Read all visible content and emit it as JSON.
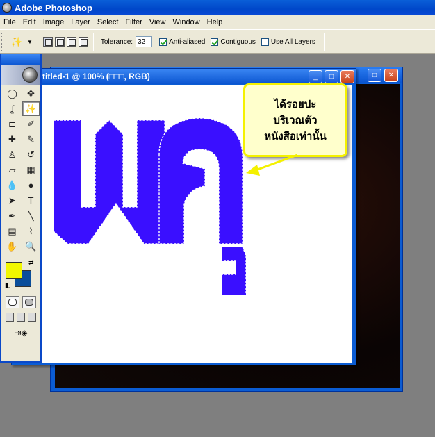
{
  "app": {
    "title": "Adobe Photoshop"
  },
  "menu": [
    "File",
    "Edit",
    "Image",
    "Layer",
    "Select",
    "Filter",
    "View",
    "Window",
    "Help"
  ],
  "options": {
    "tolerance_label": "Tolerance:",
    "tolerance_value": "32",
    "antialiased_label": "Anti-aliased",
    "antialiased_checked": true,
    "contiguous_label": "Contiguous",
    "contiguous_checked": true,
    "all_layers_label": "Use All Layers",
    "all_layers_checked": false
  },
  "document": {
    "title": "titled-1 @ 100% (□□□, RGB)",
    "canvas_text": "พฺลุ",
    "text_color": "#3a0fff"
  },
  "callout": {
    "lines": [
      "ได้รอยปะ",
      "บริเวณตัว",
      "หนังสือเท่านั้น"
    ],
    "arrow_color": "#f4f100"
  },
  "toolbox": {
    "foreground_color": "#f2f700",
    "background_color": "#0a4e9b",
    "tools": [
      {
        "name": "marquee-tool",
        "icon": "◯"
      },
      {
        "name": "move-tool",
        "icon": "✥"
      },
      {
        "name": "lasso-tool",
        "icon": "ʆ"
      },
      {
        "name": "magic-wand-tool",
        "icon": "✨"
      },
      {
        "name": "crop-tool",
        "icon": "⊏"
      },
      {
        "name": "slice-tool",
        "icon": "✐"
      },
      {
        "name": "healing-brush-tool",
        "icon": "✚"
      },
      {
        "name": "brush-tool",
        "icon": "✎"
      },
      {
        "name": "clone-stamp-tool",
        "icon": "♙"
      },
      {
        "name": "history-brush-tool",
        "icon": "↺"
      },
      {
        "name": "eraser-tool",
        "icon": "▱"
      },
      {
        "name": "gradient-tool",
        "icon": "▦"
      },
      {
        "name": "blur-tool",
        "icon": "💧"
      },
      {
        "name": "dodge-tool",
        "icon": "●"
      },
      {
        "name": "path-selection-tool",
        "icon": "➤"
      },
      {
        "name": "type-tool",
        "icon": "T"
      },
      {
        "name": "pen-tool",
        "icon": "✒"
      },
      {
        "name": "line-tool",
        "icon": "╲"
      },
      {
        "name": "notes-tool",
        "icon": "▤"
      },
      {
        "name": "eyedropper-tool",
        "icon": "⌇"
      },
      {
        "name": "hand-tool",
        "icon": "✋"
      },
      {
        "name": "zoom-tool",
        "icon": "🔍"
      }
    ]
  }
}
